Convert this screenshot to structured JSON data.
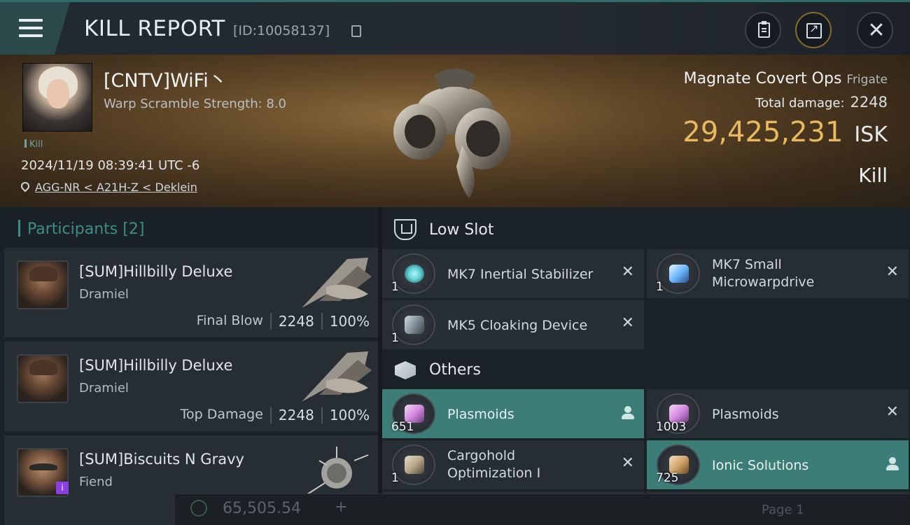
{
  "header": {
    "title": "KILL REPORT",
    "report_id": "[ID:10058137]"
  },
  "victim": {
    "name": "[CNTV]WiFi丶",
    "detail": "Warp Scramble Strength: 8.0",
    "tag": "Kill",
    "timestamp": "2024/11/19 08:39:41 UTC -6",
    "location": "AGG-NR < A21H-Z < Deklein",
    "ship_name": "Magnate Covert Ops",
    "ship_class": "Frigate",
    "total_damage_label": "Total damage:",
    "total_damage": "2248",
    "isk_value": "29,425,231",
    "isk_unit": "ISK",
    "report_type": "Kill"
  },
  "participants": {
    "title": "Participants",
    "count": "[2]",
    "rows": [
      {
        "name": "[SUM]Hillbilly Deluxe",
        "ship": "Dramiel",
        "role": "Final Blow",
        "damage": "2248",
        "percent": "100%"
      },
      {
        "name": "[SUM]Hillbilly Deluxe",
        "ship": "Dramiel",
        "role": "Top Damage",
        "damage": "2248",
        "percent": "100%"
      },
      {
        "name": "[SUM]Biscuits N Gravy",
        "ship": "Fiend",
        "badge": "i"
      }
    ]
  },
  "sections": {
    "low_slot": "Low Slot",
    "others": "Others"
  },
  "low_slot_items": [
    {
      "name": "MK7 Inertial Stabilizer",
      "qty": "1",
      "icon": "stabilizer-icon",
      "color": "#5fd0d6"
    },
    {
      "name": "MK7 Small Microwarpdrive",
      "qty": "1",
      "icon": "microwarpdrive-icon",
      "color": "#6fb8ff"
    },
    {
      "name": "MK5 Cloaking Device",
      "qty": "1",
      "icon": "cloak-icon",
      "color": "#9aa6b0"
    }
  ],
  "other_items": [
    {
      "name": "Plasmoids",
      "qty": "651",
      "icon": "plasmoid-icon",
      "color": "#d48ae0"
    },
    {
      "name": "Plasmoids",
      "qty": "1003",
      "icon": "plasmoid-icon",
      "color": "#d48ae0"
    },
    {
      "name": "Cargohold Optimization I",
      "qty": "1",
      "icon": "cargohold-icon",
      "color": "#b9a98a"
    },
    {
      "name": "Ionic Solutions",
      "qty": "725",
      "icon": "ionic-icon",
      "color": "#d2a46a"
    }
  ],
  "footer": {
    "price": "65,505.54",
    "plus": "+",
    "page": "Page 1"
  },
  "colors": {
    "accent_teal": "#3d7d78",
    "isk_gold": "#e9b960"
  }
}
